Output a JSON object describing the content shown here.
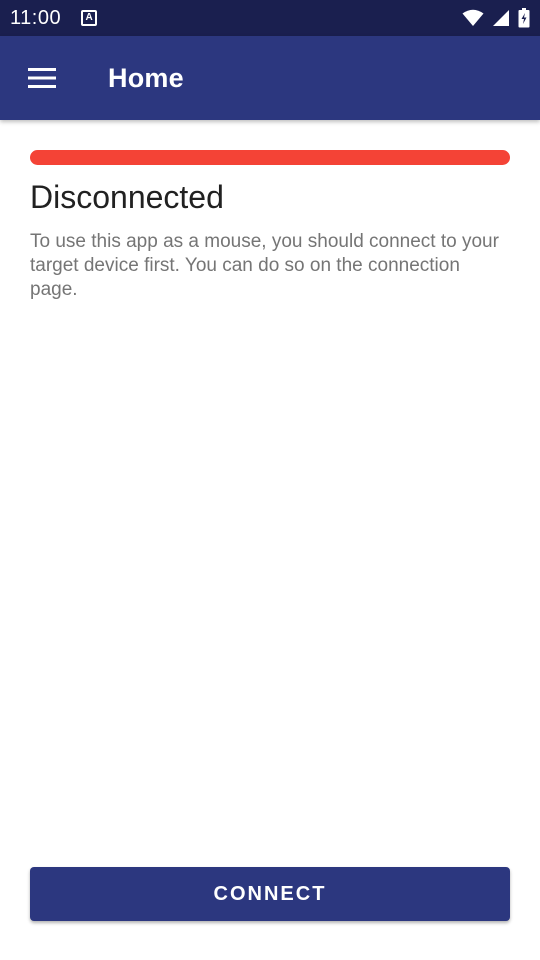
{
  "status_bar": {
    "time": "11:00",
    "notification_icon": "a-notification-icon",
    "notification_letter": "A",
    "icons": [
      "wifi-icon",
      "signal-icon",
      "battery-charging-icon"
    ]
  },
  "app_bar": {
    "menu_icon": "hamburger-menu-icon",
    "title": "Home"
  },
  "connection": {
    "indicator_color": "#f44336",
    "title": "Disconnected",
    "description": "To use this app as a mouse, you should connect to your target device first. You can do so on the connection page."
  },
  "actions": {
    "connect_label": "CONNECT"
  },
  "colors": {
    "status_bar": "#1a1f4f",
    "primary": "#2c377f",
    "error": "#f44336"
  }
}
